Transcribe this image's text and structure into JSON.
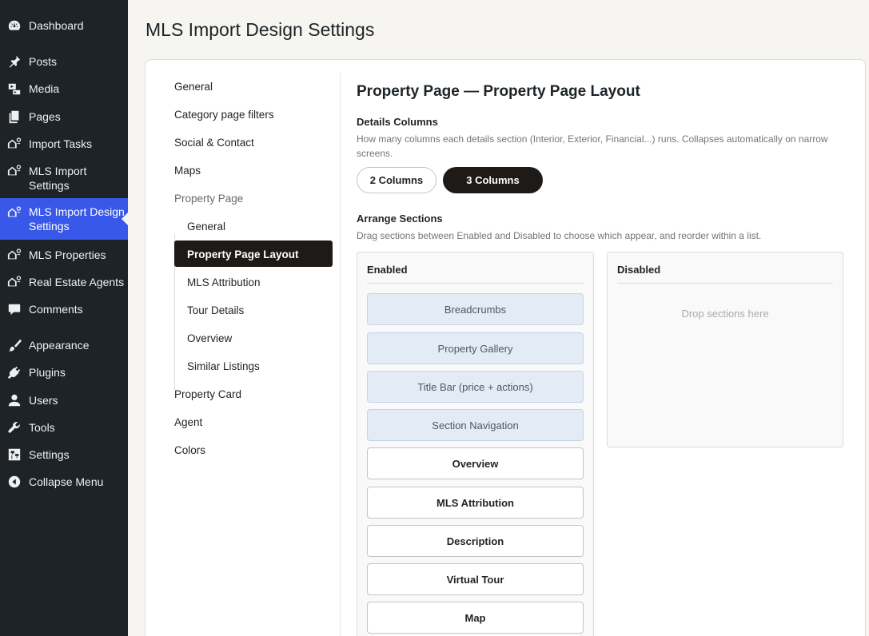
{
  "admin_menu": [
    {
      "label": "Dashboard",
      "icon": "dashboard-icon",
      "current": false
    },
    {
      "label": "Posts",
      "icon": "pin-icon",
      "current": false
    },
    {
      "label": "Media",
      "icon": "media-icon",
      "current": false
    },
    {
      "label": "Pages",
      "icon": "pages-icon",
      "current": false
    },
    {
      "label": "Import Tasks",
      "icon": "house-icon",
      "current": false
    },
    {
      "label": "MLS Import Settings",
      "icon": "house-icon",
      "current": false
    },
    {
      "label": "MLS Import Design Settings",
      "icon": "house-icon",
      "current": true
    },
    {
      "label": "MLS Properties",
      "icon": "house-icon",
      "current": false
    },
    {
      "label": "Real Estate Agents",
      "icon": "house-icon",
      "current": false
    },
    {
      "label": "Comments",
      "icon": "comments-icon",
      "current": false
    },
    {
      "label": "Appearance",
      "icon": "brush-icon",
      "current": false
    },
    {
      "label": "Plugins",
      "icon": "plug-icon",
      "current": false
    },
    {
      "label": "Users",
      "icon": "user-icon",
      "current": false
    },
    {
      "label": "Tools",
      "icon": "wrench-icon",
      "current": false
    },
    {
      "label": "Settings",
      "icon": "sliders-icon",
      "current": false
    },
    {
      "label": "Collapse Menu",
      "icon": "collapse-icon",
      "current": false
    }
  ],
  "page": {
    "title": "MLS Import Design Settings"
  },
  "settings_nav": {
    "items": [
      {
        "label": "General",
        "level": 0,
        "active": false
      },
      {
        "label": "Category page filters",
        "level": 0,
        "active": false
      },
      {
        "label": "Social & Contact",
        "level": 0,
        "active": false
      },
      {
        "label": "Maps",
        "level": 0,
        "active": false
      },
      {
        "label": "Property Page",
        "level": 0,
        "active": false,
        "parent_of_active": true
      },
      {
        "label": "General",
        "level": 1,
        "active": false
      },
      {
        "label": "Property Page Layout",
        "level": 1,
        "active": true
      },
      {
        "label": "MLS Attribution",
        "level": 1,
        "active": false
      },
      {
        "label": "Tour Details",
        "level": 1,
        "active": false
      },
      {
        "label": "Overview",
        "level": 1,
        "active": false
      },
      {
        "label": "Similar Listings",
        "level": 1,
        "active": false
      },
      {
        "label": "Property Card",
        "level": 0,
        "active": false
      },
      {
        "label": "Agent",
        "level": 0,
        "active": false
      },
      {
        "label": "Colors",
        "level": 0,
        "active": false
      }
    ]
  },
  "panel": {
    "title": "Property Page — Property Page Layout",
    "details_columns": {
      "label": "Details Columns",
      "description": "How many columns each details section (Interior, Exterior, Financial...) runs. Collapses automatically on narrow screens.",
      "options": [
        "2 Columns",
        "3 Columns"
      ],
      "selected": "3 Columns"
    },
    "arrange": {
      "label": "Arrange Sections",
      "description": "Drag sections between Enabled and Disabled to choose which appear, and reorder within a list.",
      "enabled_heading": "Enabled",
      "disabled_heading": "Disabled",
      "disabled_placeholder": "Drop sections here",
      "enabled_sections": [
        {
          "label": "Breadcrumbs",
          "style": "locked"
        },
        {
          "label": "Property Gallery",
          "style": "locked"
        },
        {
          "label": "Title Bar (price + actions)",
          "style": "locked"
        },
        {
          "label": "Section Navigation",
          "style": "locked"
        },
        {
          "label": "Overview",
          "style": "movable"
        },
        {
          "label": "MLS Attribution",
          "style": "movable"
        },
        {
          "label": "Description",
          "style": "movable"
        },
        {
          "label": "Virtual Tour",
          "style": "movable"
        },
        {
          "label": "Map",
          "style": "movable"
        }
      ],
      "disabled_sections": []
    }
  },
  "colors": {
    "sidebar_bg": "#1d2327",
    "sidebar_current": "#3858e9",
    "accent_dark": "#1d1a17",
    "locked_chip_bg": "#e3ebf5"
  }
}
